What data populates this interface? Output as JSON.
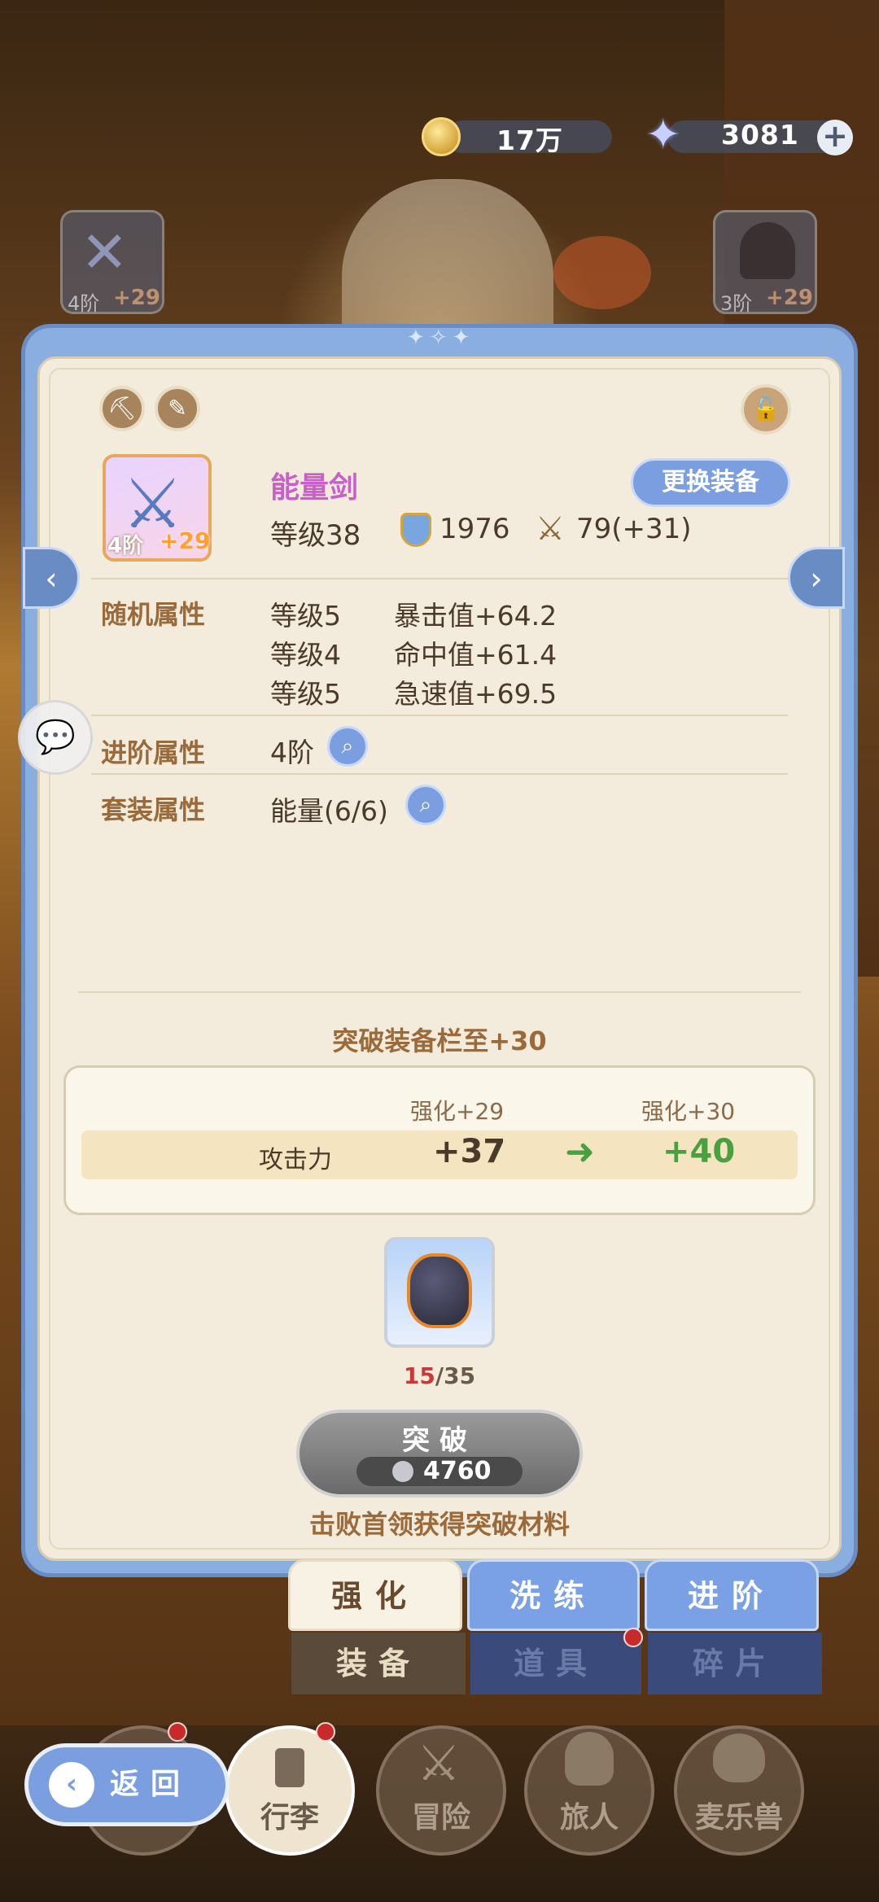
{
  "currency": {
    "coins": "17万",
    "gems": "3081",
    "gold_color": "#d4a53a",
    "gem_color": "#c8d0ff"
  },
  "side_slots": {
    "left": {
      "tier": "4阶",
      "plus": "+29",
      "icon": "sword-icon"
    },
    "right": {
      "tier": "3阶",
      "plus": "+29",
      "icon": "helmet-icon"
    }
  },
  "item": {
    "tier": "4阶",
    "plus": "+29",
    "name": "能量剑",
    "swap_label": "更换装备",
    "level": "等级38",
    "defense": "1976",
    "attack": "79(+31)",
    "icon": "sword-icon"
  },
  "random_attrs": {
    "label": "随机属性",
    "rows": [
      {
        "level": "等级5",
        "value": "暴击值+64.2"
      },
      {
        "level": "等级4",
        "value": "命中值+61.4"
      },
      {
        "level": "等级5",
        "value": "急速值+69.5"
      }
    ]
  },
  "advance_attr": {
    "label": "进阶属性",
    "value": "4阶"
  },
  "set_attr": {
    "label": "套装属性",
    "value": "能量(6/6)"
  },
  "breakthrough": {
    "title": "突破装备栏至+30",
    "head_old": "强化+29",
    "head_new": "强化+30",
    "stat_label": "攻击力",
    "old_value": "+37",
    "new_value": "+40",
    "material_have": "15",
    "material_need": "/35",
    "button_label": "突破",
    "cost": "4760",
    "hint": "击败首领获得突破材料"
  },
  "sub_tabs": [
    {
      "label": "强化",
      "active": true
    },
    {
      "label": "洗练",
      "active": false
    },
    {
      "label": "进阶",
      "active": false
    }
  ],
  "cat_tabs": [
    {
      "label": "装备",
      "active": true
    },
    {
      "label": "道具",
      "active": false
    },
    {
      "label": "碎片",
      "active": false
    }
  ],
  "bottom_nav": {
    "back": "返回",
    "items": [
      {
        "label": "行李"
      },
      {
        "label": "冒险"
      },
      {
        "label": "旅人"
      },
      {
        "label": "麦乐兽"
      }
    ]
  }
}
